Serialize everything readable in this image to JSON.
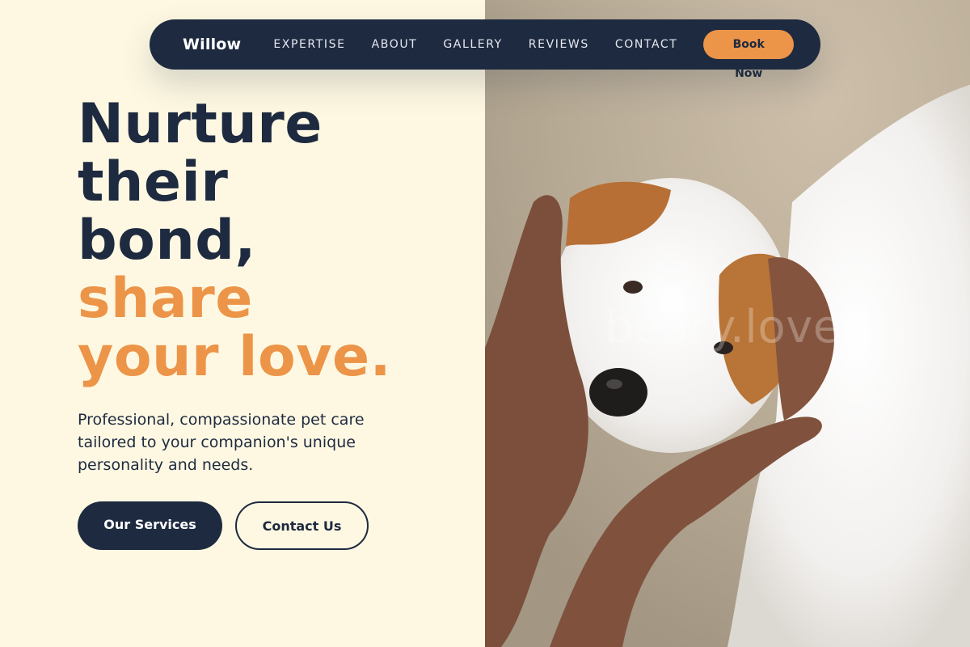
{
  "nav": {
    "brand": "Willow",
    "links": [
      "EXPERTISE",
      "ABOUT",
      "GALLERY",
      "REVIEWS",
      "CONTACT"
    ],
    "cta": "Book Now"
  },
  "hero": {
    "title_lines": [
      "Nurture",
      "their",
      "bond,"
    ],
    "title_accent_lines": [
      "share",
      "your love."
    ],
    "subtitle": "Professional, compassionate pet care tailored to your companion's unique personality and needs.",
    "primary_button": "Our Services",
    "secondary_button": "Contact Us"
  },
  "image": {
    "watermark": "beary.love",
    "subject": "puppy-held-in-hands"
  },
  "colors": {
    "navy": "#1e2a40",
    "accent": "#ec9448",
    "cream": "#fef8e2"
  }
}
